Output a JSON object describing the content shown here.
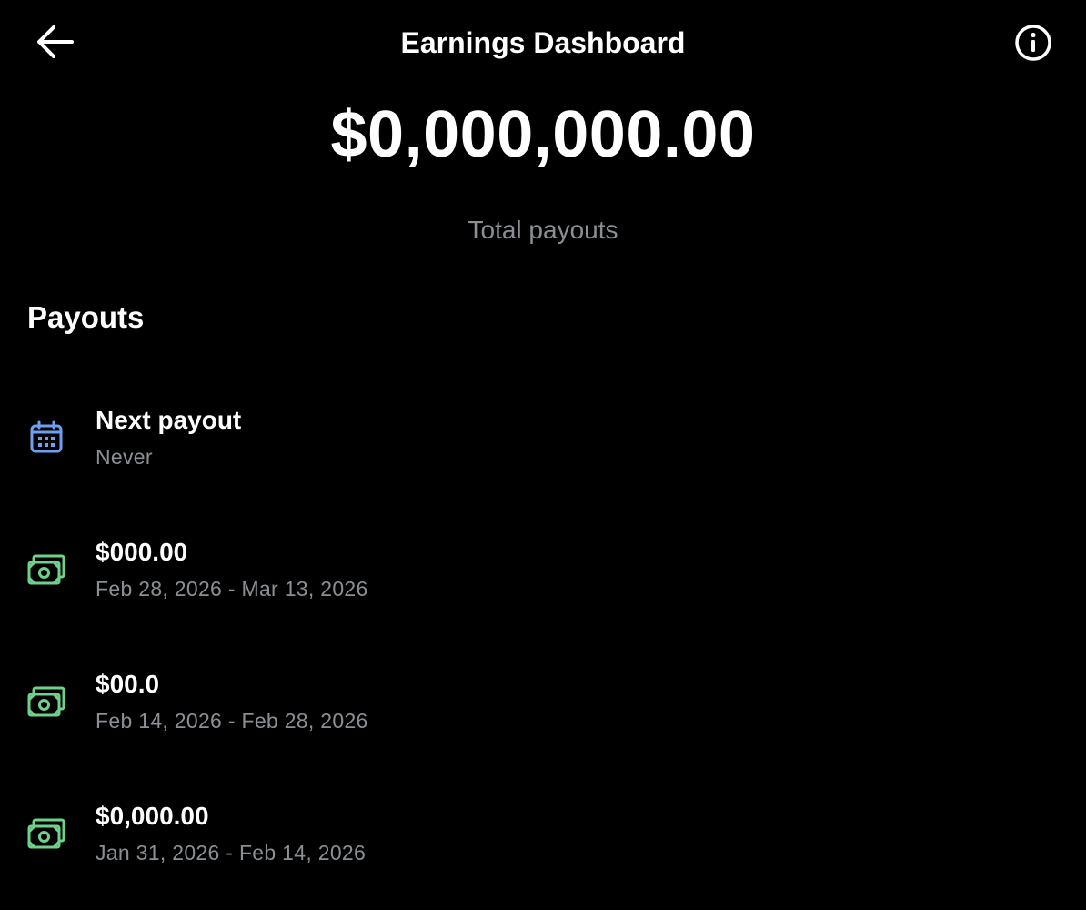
{
  "header": {
    "title": "Earnings Dashboard",
    "back_icon": "arrow-left-icon",
    "info_icon": "info-circle-icon"
  },
  "summary": {
    "total_amount": "$0,000,000.00",
    "total_label": "Total payouts"
  },
  "payouts": {
    "section_title": "Payouts",
    "next": {
      "title": "Next payout",
      "subtitle": "Never",
      "icon": "calendar-icon"
    },
    "items": [
      {
        "amount": "$000.00",
        "period": "Feb 28, 2026 - Mar 13, 2026",
        "icon": "money-icon"
      },
      {
        "amount": "$00.0",
        "period": "Feb 14, 2026 - Feb 28, 2026",
        "icon": "money-icon"
      },
      {
        "amount": "$0,000.00",
        "period": "Jan 31, 2026 - Feb 14, 2026",
        "icon": "money-icon"
      }
    ]
  },
  "colors": {
    "background": "#000000",
    "text_primary": "#ffffff",
    "text_secondary": "#8b8f94",
    "calendar_accent": "#6ea0ef",
    "money_accent": "#6fd28a"
  }
}
